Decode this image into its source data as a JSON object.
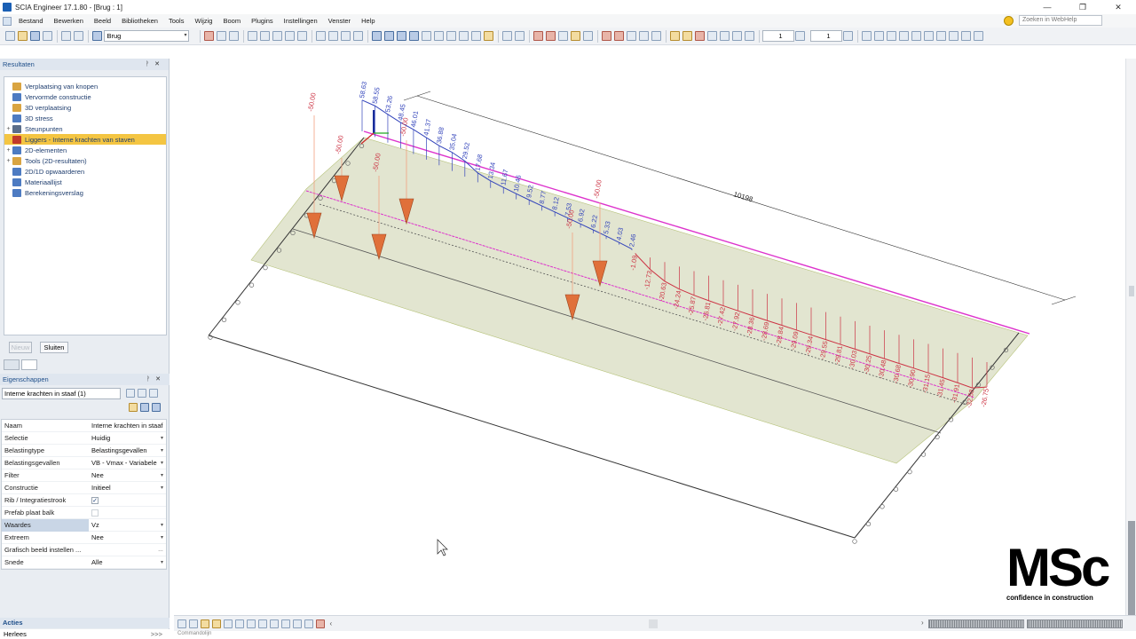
{
  "window": {
    "title": "SCIA Engineer 17.1.80 - [Brug : 1]",
    "buttons": [
      "—",
      "❐",
      "✕"
    ]
  },
  "menu": {
    "items": [
      "Bestand",
      "Bewerken",
      "Beeld",
      "Bibliotheken",
      "Tools",
      "Wijzig",
      "Boom",
      "Plugins",
      "Instellingen",
      "Venster",
      "Help"
    ],
    "search_placeholder": "Zoeken in WebHelp"
  },
  "toolbar": {
    "project_combo": "Brug",
    "spin1": "1",
    "spin2": "1"
  },
  "results_panel": {
    "title": "Resultaten",
    "items": [
      {
        "label": "Verplaatsing van knopen",
        "expand": "",
        "color": "#d9a441"
      },
      {
        "label": "Vervormde constructie",
        "expand": "",
        "color": "#4d7bc2"
      },
      {
        "label": "3D verplaatsing",
        "expand": "",
        "color": "#d9a441"
      },
      {
        "label": "3D stress",
        "expand": "",
        "color": "#4d7bc2"
      },
      {
        "label": "Steunpunten",
        "expand": "+",
        "color": "#5a6d8a"
      },
      {
        "label": "Liggers - Interne krachten van staven",
        "expand": "",
        "color": "#c0392b",
        "selected": true
      },
      {
        "label": "2D-elementen",
        "expand": "+",
        "color": "#4d7bc2"
      },
      {
        "label": "Tools (2D-resultaten)",
        "expand": "+",
        "color": "#d9a441"
      },
      {
        "label": "2D/1D opwaarderen",
        "expand": "",
        "color": "#4d7bc2"
      },
      {
        "label": "Materiaallijst",
        "expand": "",
        "color": "#4d7bc2"
      },
      {
        "label": "Berekeningsverslag",
        "expand": "",
        "color": "#4d7bc2"
      }
    ],
    "new_button": "Nieuw",
    "close_button": "Sluiten"
  },
  "properties_panel": {
    "title": "Eigenschappen",
    "selector": "Interne krachten in staaf (1)",
    "rows": [
      {
        "key": "Naam",
        "value": "Interne krachten in staaf",
        "dd": false
      },
      {
        "key": "Selectie",
        "value": "Huidig",
        "dd": true
      },
      {
        "key": "Belastingtype",
        "value": "Belastingsgevallen",
        "dd": true
      },
      {
        "key": "Belastingsgevallen",
        "value": "VB - Vmax - Variabele",
        "dd": true
      },
      {
        "key": "Filter",
        "value": "Nee",
        "dd": true
      },
      {
        "key": "Constructie",
        "value": "Initieel",
        "dd": true
      },
      {
        "key": "Rib / Integratiestrook",
        "value": "",
        "check": "✓",
        "dd": false
      },
      {
        "key": "Prefab plaat balk",
        "value": "",
        "check": "",
        "dd": false
      },
      {
        "key": "Waardes",
        "value": "Vz",
        "dd": true,
        "hl": true
      },
      {
        "key": "Extreem",
        "value": "Nee",
        "dd": true
      },
      {
        "key": "Grafisch beeld instellen ...",
        "value": "",
        "dd": false,
        "ellipsis": true
      },
      {
        "key": "Snede",
        "value": "Alle",
        "dd": true
      }
    ]
  },
  "actions": {
    "title": "Acties",
    "reload": "Herlees",
    "more": ">>>"
  },
  "command_line": "Commandolijn",
  "model": {
    "dimension_label": "10198",
    "blue_values": [
      "58.63",
      "58.55",
      "53.26",
      "48.45",
      "46.01",
      "41.37",
      "36.88",
      "35.04",
      "29.52",
      "17.68",
      "13.34",
      "11.67",
      "10.46",
      "9.52",
      "8.77",
      "8.12",
      "7.53",
      "6.92",
      "6.22",
      "5.33",
      "4.03",
      "2.46"
    ],
    "red_values": [
      "-1.09",
      "-12.73",
      "-20.63",
      "-24.24",
      "-25.87",
      "-26.81",
      "-27.42",
      "-27.92",
      "-28.36",
      "-28.69",
      "-28.84",
      "-29.09",
      "-29.34",
      "-29.55",
      "-29.81",
      "-30.03",
      "-30.25",
      "-30.48",
      "-30.68",
      "-30.90",
      "-31.15",
      "-31.45",
      "-31.91",
      "-32.58",
      "-26.75"
    ],
    "load_values": [
      "-50.00",
      "-50.00",
      "-50.00",
      "-50.00",
      "-50.00",
      "-50.00"
    ],
    "colors": {
      "positive": "#3344bb",
      "negative": "#cc3344",
      "slab": "#d8dcc0",
      "edge": "#dd33cc",
      "load": "#e0703a"
    }
  },
  "logo": {
    "text": "MSc",
    "tagline": "confidence in construction"
  }
}
